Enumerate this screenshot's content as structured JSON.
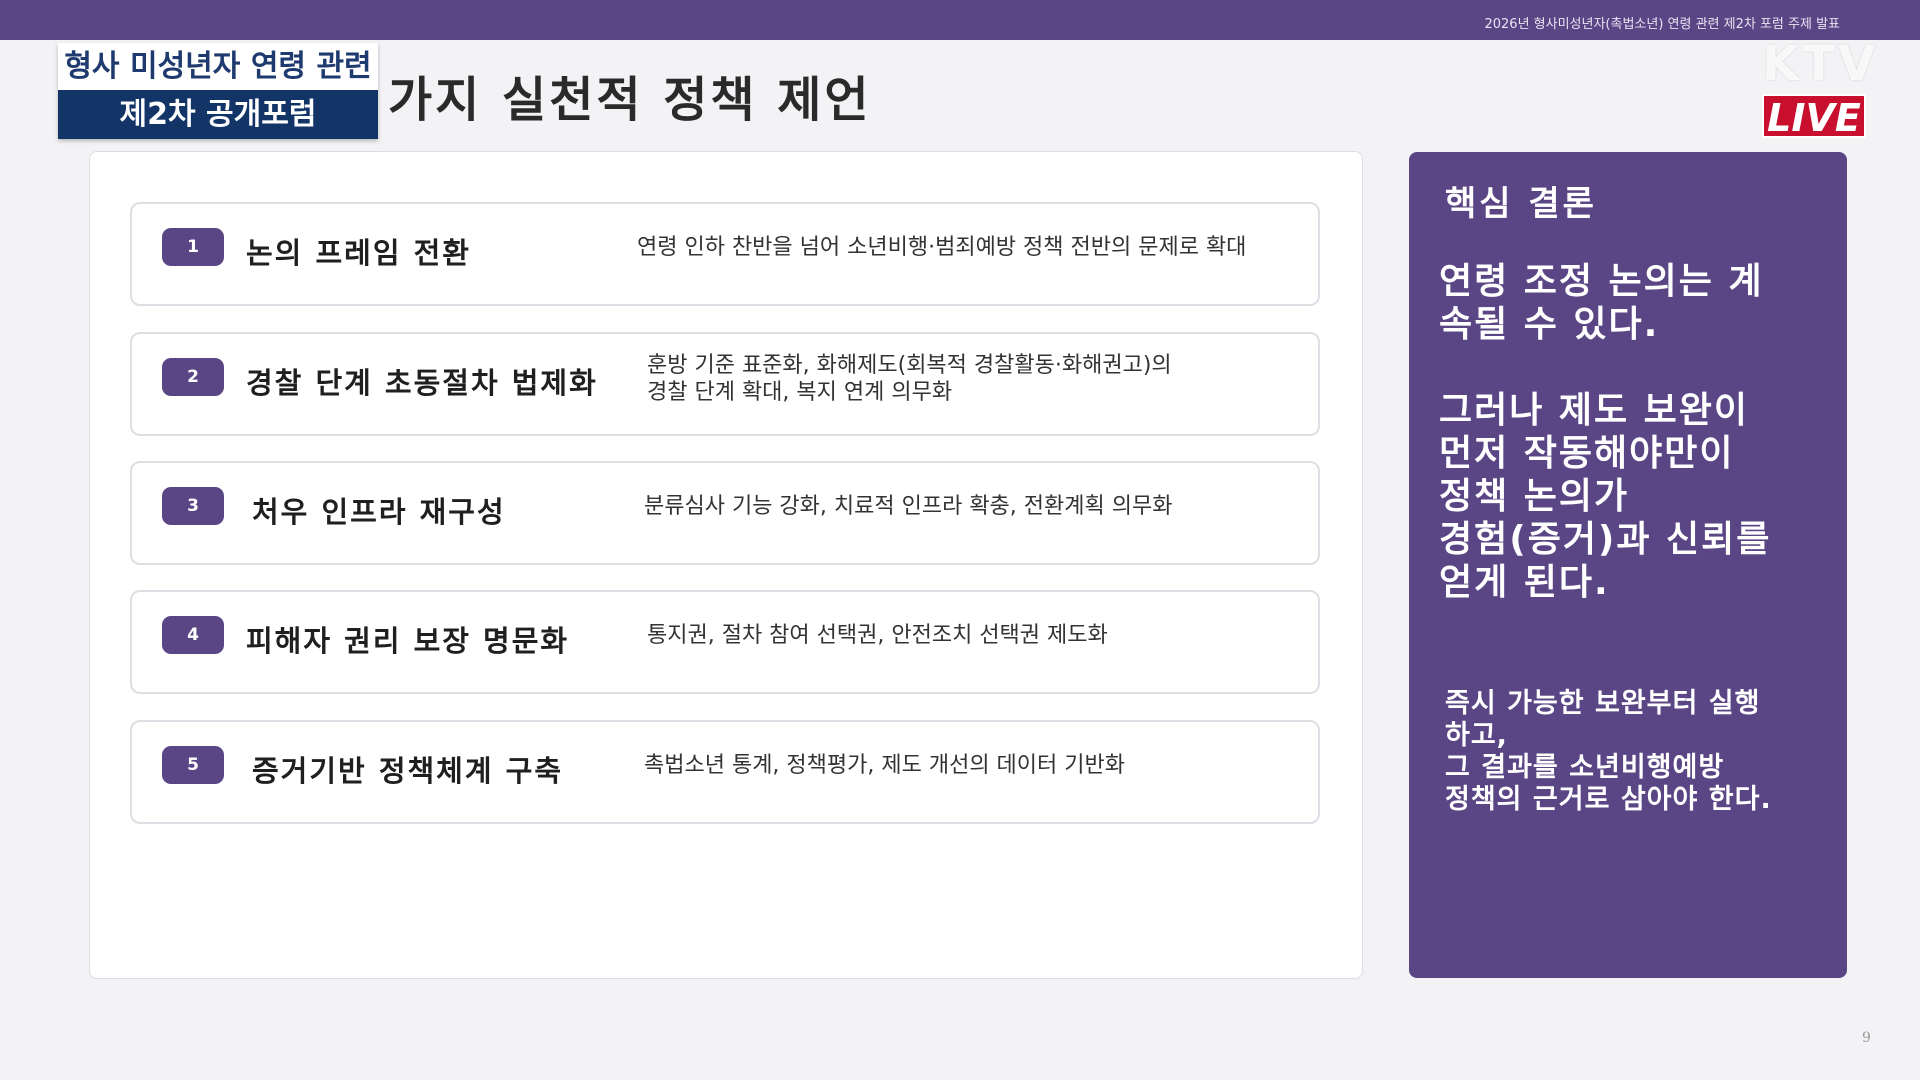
{
  "broadcast": {
    "ticker": "2026년 형사미성년자(촉법소년) 연령 관련 제2차 포럼 주제 발표",
    "channel_logo": "KTV",
    "live_label": "LIVE"
  },
  "badge": {
    "line1": "형사 미성년자 연령 관련",
    "line2": "제2차 공개포럼"
  },
  "slide": {
    "title": "가지 실천적 정책 제언",
    "page_number": "9"
  },
  "items": [
    {
      "number": "1",
      "title": "논의 프레임 전환",
      "desc": [
        "연령 인하 찬반을 넘어 소년비행·범죄예방 정책 전반의 문제로 확대"
      ]
    },
    {
      "number": "2",
      "title": "경찰 단계 초동절차 법제화",
      "desc": [
        "훈방 기준 표준화, 화해제도(회복적 경찰활동·화해권고)의",
        "경찰 단계 확대, 복지 연계 의무화"
      ]
    },
    {
      "number": "3",
      "title": "처우 인프라 재구성",
      "desc": [
        "분류심사 기능 강화, 치료적 인프라 확충, 전환계획 의무화"
      ]
    },
    {
      "number": "4",
      "title": "피해자 권리 보장 명문화",
      "desc": [
        "통지권, 절차 참여 선택권, 안전조치 선택권 제도화"
      ]
    },
    {
      "number": "5",
      "title": "증거기반 정책체계 구축",
      "desc": [
        "촉법소년 통계, 정책평가, 제도 개선의 데이터 기반화"
      ]
    }
  ],
  "conclusion": {
    "heading": "핵심 결론",
    "para1": [
      "연령 조정 논의는 계",
      "속될 수 있다."
    ],
    "para2": [
      "그러나 제도 보완이",
      "먼저 작동해야만이",
      "정책 논의가",
      "경험(증거)과 신뢰를",
      "얻게 된다."
    ],
    "para3": [
      "즉시 가능한 보완부터 실행",
      "하고,",
      "그 결과를 소년비행예방",
      "정책의 근거로 삼아야 한다."
    ]
  }
}
